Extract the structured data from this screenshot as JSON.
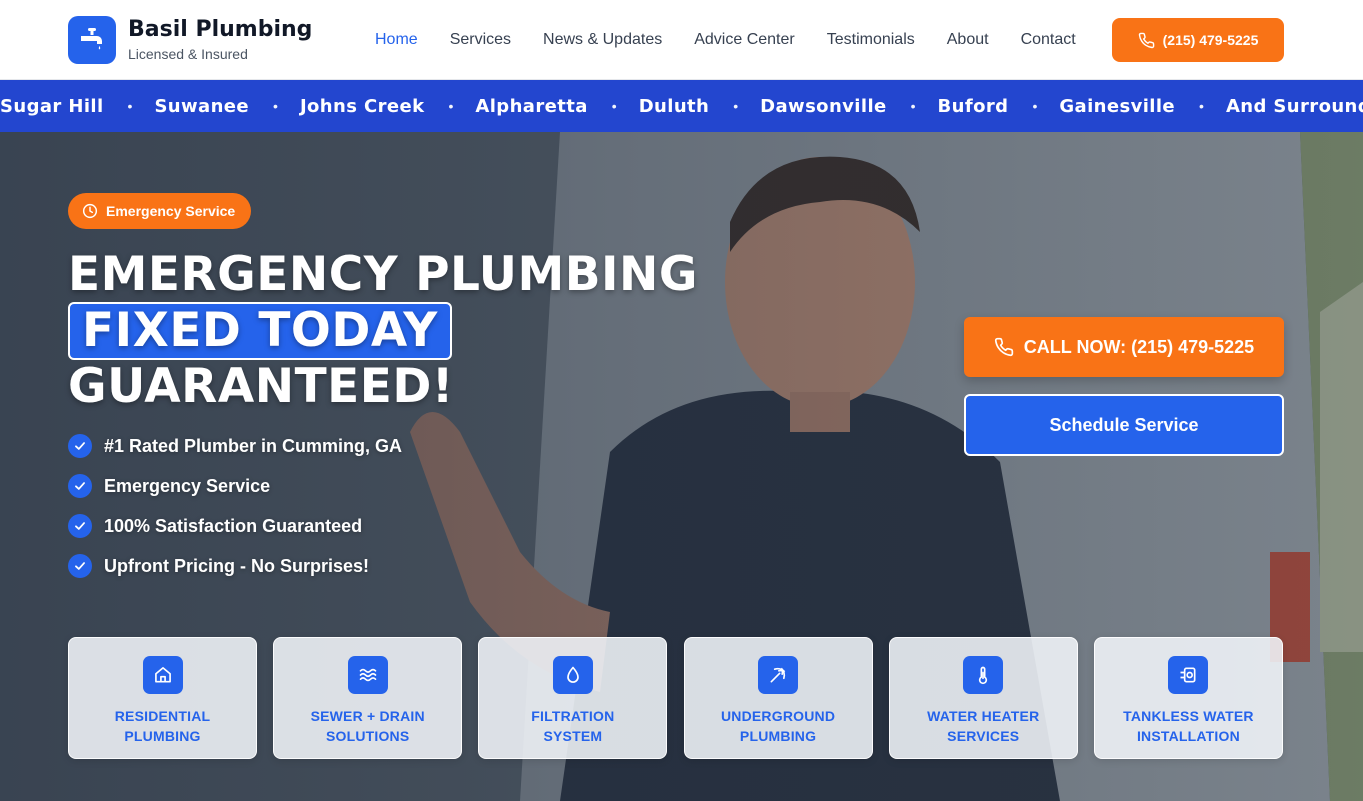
{
  "brand": {
    "name": "Basil Plumbing",
    "tagline": "Licensed & Insured",
    "logo_icon": "faucet-icon"
  },
  "nav": {
    "items": [
      {
        "label": "Home",
        "active": true
      },
      {
        "label": "Services"
      },
      {
        "label": "News & Updates"
      },
      {
        "label": "Advice Center"
      },
      {
        "label": "Testimonials"
      },
      {
        "label": "About"
      },
      {
        "label": "Contact"
      }
    ],
    "phone_label": "(215) 479-5225"
  },
  "ticker": {
    "areas": [
      "Sugar Hill",
      "Suwanee",
      "Johns Creek",
      "Alpharetta",
      "Duluth",
      "Dawsonville",
      "Buford",
      "Gainesville",
      "And Surrounding Areas"
    ],
    "separator": "•"
  },
  "hero": {
    "badge": "Emergency Service",
    "headline": {
      "line1": "EMERGENCY PLUMBING",
      "highlight": "FIXED TODAY",
      "line3": "GUARANTEED!"
    },
    "checks": [
      "#1 Rated Plumber in Cumming, GA",
      "Emergency Service",
      "100% Satisfaction Guaranteed",
      "Upfront Pricing - No Surprises!"
    ],
    "cta_call": "CALL NOW: (215) 479-5225",
    "cta_schedule": "Schedule Service"
  },
  "services": [
    {
      "line1": "Residential",
      "line2": "Plumbing",
      "icon": "house-icon"
    },
    {
      "line1": "Sewer + Drain",
      "line2": "Solutions",
      "icon": "waves-icon"
    },
    {
      "line1": "Filtration",
      "line2": "System",
      "icon": "droplet-icon"
    },
    {
      "line1": "Underground",
      "line2": "Plumbing",
      "icon": "pickaxe-icon"
    },
    {
      "line1": "Water Heater",
      "line2": "Services",
      "icon": "thermometer-icon"
    },
    {
      "line1": "Tankless Water",
      "line2": "Installation",
      "icon": "boiler-icon"
    }
  ],
  "colors": {
    "primary_blue": "#2563eb",
    "ticker_blue": "#2346cf",
    "accent_orange": "#f97316"
  }
}
